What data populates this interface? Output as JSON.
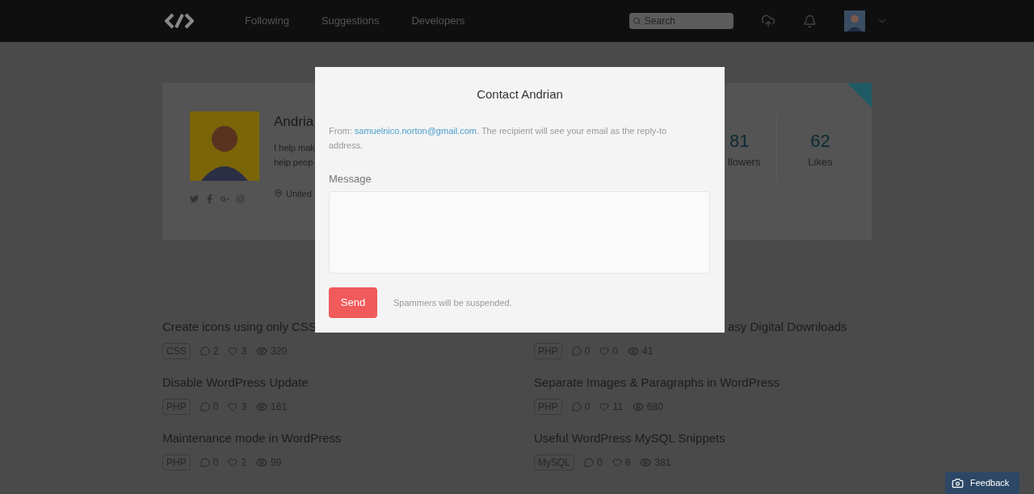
{
  "nav": {
    "links": [
      {
        "label": "Following",
        "selected": false
      },
      {
        "label": "Suggestions",
        "selected": false
      },
      {
        "label": "Developers",
        "selected": false
      }
    ],
    "search": {
      "placeholder": "Search"
    }
  },
  "profile": {
    "name": "Andria",
    "bio_lines": [
      "I help mak",
      "help peop"
    ],
    "location": "United",
    "featured": true,
    "stats": [
      {
        "value": "81",
        "label": "llowers"
      },
      {
        "value": "62",
        "label": "Likes"
      }
    ]
  },
  "posts": [
    {
      "title": "Create icons using only CSS",
      "tag": "CSS",
      "comments": "2",
      "likes": "3",
      "views": "320"
    },
    {
      "title": "asy Digital Downloads",
      "tag": "PHP",
      "comments": "0",
      "likes": "0",
      "views": "41"
    },
    {
      "title": "Disable WordPress Update",
      "tag": "PHP",
      "comments": "0",
      "likes": "3",
      "views": "161"
    },
    {
      "title": "Separate Images & Paragraphs in WordPress",
      "tag": "PHP",
      "comments": "0",
      "likes": "11",
      "views": "680"
    },
    {
      "title": "Maintenance mode in WordPress",
      "tag": "PHP",
      "comments": "0",
      "likes": "2",
      "views": "99"
    },
    {
      "title": "Useful WordPress MySQL Snippets",
      "tag": "MySQL",
      "comments": "0",
      "likes": "8",
      "views": "381"
    }
  ],
  "modal": {
    "title": "Contact Andrian",
    "from_label": "From:",
    "email": "samuelnico.norton@gmail.com",
    "note": ". The recipient will see your email as the reply-to address.",
    "message_label": "Message",
    "send": "Send",
    "spam_note": "Spammers will be suspended."
  },
  "feedback": {
    "label": "Feedback"
  }
}
